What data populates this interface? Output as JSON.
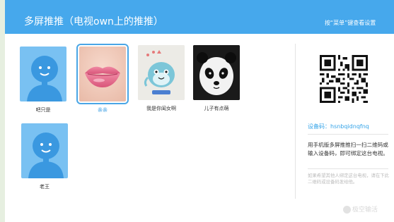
{
  "header": {
    "title": "多屏推推（电视own上的推推）",
    "hint": "按“菜单”键查看设置"
  },
  "users": [
    {
      "name": "吧只是",
      "avatar": "default-person-icon",
      "selected": false
    },
    {
      "name": "亲亲",
      "avatar": "lips-photo",
      "selected": true
    },
    {
      "name": "我是你闺女啊",
      "avatar": "cartoon-whale-sticker",
      "selected": false
    },
    {
      "name": "儿子有点萌",
      "avatar": "panda-photo",
      "selected": false
    },
    {
      "name": "老王",
      "avatar": "default-person-icon",
      "selected": false
    }
  ],
  "panel": {
    "qr_icon": "qr-code-icon",
    "device_code_label": "设备码：hsnbqidnqfnq",
    "bind_text": "用手机版多屏推推扫一扫二维码或输入设备码，即可绑定这台电视。",
    "note": "如果希望其他人绑定这台电视，请在下此二维码或设备码发给他。"
  },
  "watermark": "极空输活",
  "colors": {
    "header": "#46a8ec",
    "accent": "#33a3e8",
    "avatar_bg": "#79c1f2"
  }
}
